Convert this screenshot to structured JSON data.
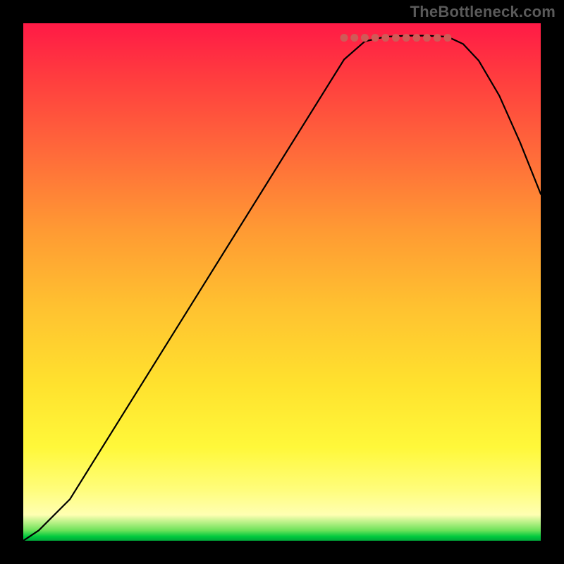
{
  "watermark": "TheBottleneck.com",
  "colors": {
    "curve": "#000000",
    "marker": "#cf5a57"
  },
  "chart_data": {
    "type": "line",
    "title": "",
    "xlabel": "",
    "ylabel": "",
    "xlim": [
      0,
      100
    ],
    "ylim": [
      0,
      100
    ],
    "curve_points": [
      [
        0,
        0
      ],
      [
        3,
        2
      ],
      [
        9,
        8
      ],
      [
        62,
        93
      ],
      [
        66,
        96.5
      ],
      [
        70,
        97.4
      ],
      [
        74,
        97.6
      ],
      [
        78,
        97.6
      ],
      [
        82,
        97.4
      ],
      [
        85,
        96.0
      ],
      [
        88,
        92.8
      ],
      [
        92,
        86
      ],
      [
        96,
        77
      ],
      [
        100,
        67
      ]
    ],
    "valley_markers_x": [
      62,
      64,
      66,
      68,
      70,
      72,
      74,
      76,
      78,
      80,
      82
    ],
    "valley_marker_y": 97.2
  }
}
